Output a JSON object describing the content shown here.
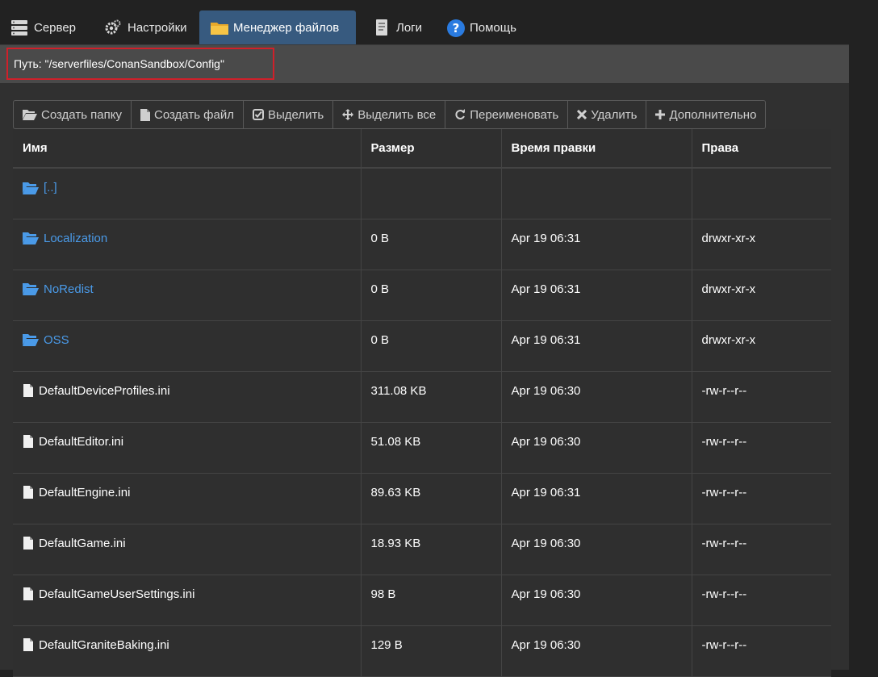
{
  "nav": {
    "tabs": [
      {
        "label": "Сервер",
        "icon": "server-icon",
        "active": false
      },
      {
        "label": "Настройки",
        "icon": "gears-icon",
        "active": false
      },
      {
        "label": "Менеджер файлов",
        "icon": "folder-icon",
        "active": true
      },
      {
        "label": "Логи",
        "icon": "log-file-icon",
        "active": false
      },
      {
        "label": "Помощь",
        "icon": "help-icon",
        "active": false
      }
    ]
  },
  "path": {
    "text": "Путь: \"/serverfiles/ConanSandbox/Config\""
  },
  "toolbar": {
    "buttons": [
      {
        "label": "Создать папку",
        "icon": "folder-open-icon"
      },
      {
        "label": "Создать файл",
        "icon": "file-icon"
      },
      {
        "label": "Выделить",
        "icon": "check-square-icon"
      },
      {
        "label": "Выделить все",
        "icon": "move-arrows-icon"
      },
      {
        "label": "Переименовать",
        "icon": "refresh-icon"
      },
      {
        "label": "Удалить",
        "icon": "close-icon"
      },
      {
        "label": "Дополнительно",
        "icon": "plus-icon"
      }
    ]
  },
  "table": {
    "headers": [
      "Имя",
      "Размер",
      "Время правки",
      "Права"
    ],
    "rows": [
      {
        "name": "[..]",
        "type": "folder",
        "size": "",
        "modified": "",
        "perms": ""
      },
      {
        "name": "Localization",
        "type": "folder",
        "size": "0 B",
        "modified": "Apr 19 06:31",
        "perms": "drwxr-xr-x"
      },
      {
        "name": "NoRedist",
        "type": "folder",
        "size": "0 B",
        "modified": "Apr 19 06:31",
        "perms": "drwxr-xr-x"
      },
      {
        "name": "OSS",
        "type": "folder",
        "size": "0 B",
        "modified": "Apr 19 06:31",
        "perms": "drwxr-xr-x"
      },
      {
        "name": "DefaultDeviceProfiles.ini",
        "type": "file",
        "size": "311.08 KB",
        "modified": "Apr 19 06:30",
        "perms": "-rw-r--r--"
      },
      {
        "name": "DefaultEditor.ini",
        "type": "file",
        "size": "51.08 KB",
        "modified": "Apr 19 06:30",
        "perms": "-rw-r--r--"
      },
      {
        "name": "DefaultEngine.ini",
        "type": "file",
        "size": "89.63 KB",
        "modified": "Apr 19 06:31",
        "perms": "-rw-r--r--"
      },
      {
        "name": "DefaultGame.ini",
        "type": "file",
        "size": "18.93 KB",
        "modified": "Apr 19 06:30",
        "perms": "-rw-r--r--"
      },
      {
        "name": "DefaultGameUserSettings.ini",
        "type": "file",
        "size": "98 B",
        "modified": "Apr 19 06:30",
        "perms": "-rw-r--r--"
      },
      {
        "name": "DefaultGraniteBaking.ini",
        "type": "file",
        "size": "129 B",
        "modified": "Apr 19 06:30",
        "perms": "-rw-r--r--"
      }
    ]
  },
  "colors": {
    "accent": "#375a7f",
    "link": "#4a9ae8",
    "highlight_border": "#d0202a"
  }
}
